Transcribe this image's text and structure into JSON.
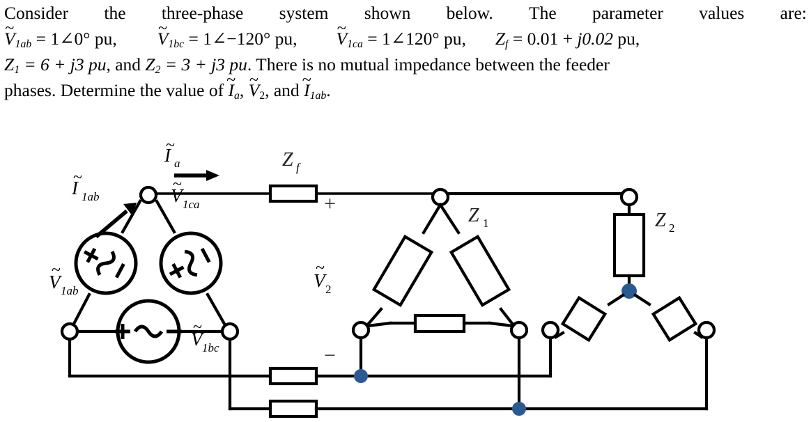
{
  "problem": {
    "line1_part1": "Consider",
    "line1_part2": "the",
    "line1_part3": "three-phase",
    "line1_part4": "system",
    "line1_part5": "shown",
    "line1_part6": "below.",
    "line1_part7": "The",
    "line1_part8": "parameter",
    "line1_part9": "values",
    "line1_part10": "are:",
    "params": [
      {
        "symbol": "V",
        "tilde": "~",
        "sub": "1ab",
        "eq": "= 1",
        "angle": "∠",
        "value": "0°",
        "unit": "pu",
        "trail": ","
      },
      {
        "symbol": "V",
        "tilde": "~",
        "sub": "1bc",
        "eq": "= 1",
        "angle": "∠",
        "value": "−120°",
        "unit": "pu",
        "trail": ","
      },
      {
        "symbol": "V",
        "tilde": "~",
        "sub": "1ca",
        "eq": "= 1",
        "angle": "∠",
        "value": "120°",
        "unit": "pu",
        "trail": ","
      },
      {
        "symbol": "Z",
        "tilde": "",
        "sub": "f",
        "eq": "= 0.01 +",
        "angle": "",
        "value": "j0.02",
        "unit": "pu",
        "trail": ","
      }
    ],
    "line3_z1": "Z",
    "line3_z1_sub": "1",
    "line3_z1_val": "= 6 + j3 pu",
    "line3_sep": ", and",
    "line3_z2": "Z",
    "line3_z2_sub": "2",
    "line3_z2_val": "= 3 + j3 pu",
    "line3_tail": ".  There is no mutual impedance between the feeder",
    "line4_pre": "phases.  Determine the value of",
    "line4_i": "I",
    "line4_i_sub": "a",
    "line4_c1": ",",
    "line4_v": "V",
    "line4_v_sub": "2",
    "line4_c2": ", and",
    "line4_i2": "I",
    "line4_i2_sub": "1ab",
    "line4_end": "."
  },
  "circuit": {
    "title": "three-phase delta source with feeder, delta load Z1 and wye load Z2",
    "labels": {
      "Ia": "I",
      "Ia_sub": "a",
      "I1ab": "I",
      "I1ab_sub": "1ab",
      "V1ab": "V",
      "V1ab_sub": "1ab",
      "V1bc": "V",
      "V1bc_sub": "1bc",
      "V1ca": "V",
      "V1ca_sub": "1ca",
      "V2": "V",
      "V2_sub": "2",
      "Zf": "Z",
      "Zf_sub": "f",
      "Z1": "Z",
      "Z1_sub": "1",
      "Z2": "Z",
      "Z2_sub": "2",
      "plus": "+",
      "minus": "−",
      "tilde": "~",
      "src_plus": "+",
      "src_minus": "−",
      "src_ac": "∿"
    },
    "colors": {
      "wire": "#000000",
      "junction_dot": "#2a5a92",
      "terminal_fill": "#ffffff",
      "background": "#ffffff"
    },
    "elements": {
      "sources": [
        "V1ab",
        "V1bc",
        "V1ca"
      ],
      "feeder_impedances": [
        "Zf",
        "Zf",
        "Zf"
      ],
      "delta_load": "Z1",
      "wye_load": "Z2"
    }
  }
}
